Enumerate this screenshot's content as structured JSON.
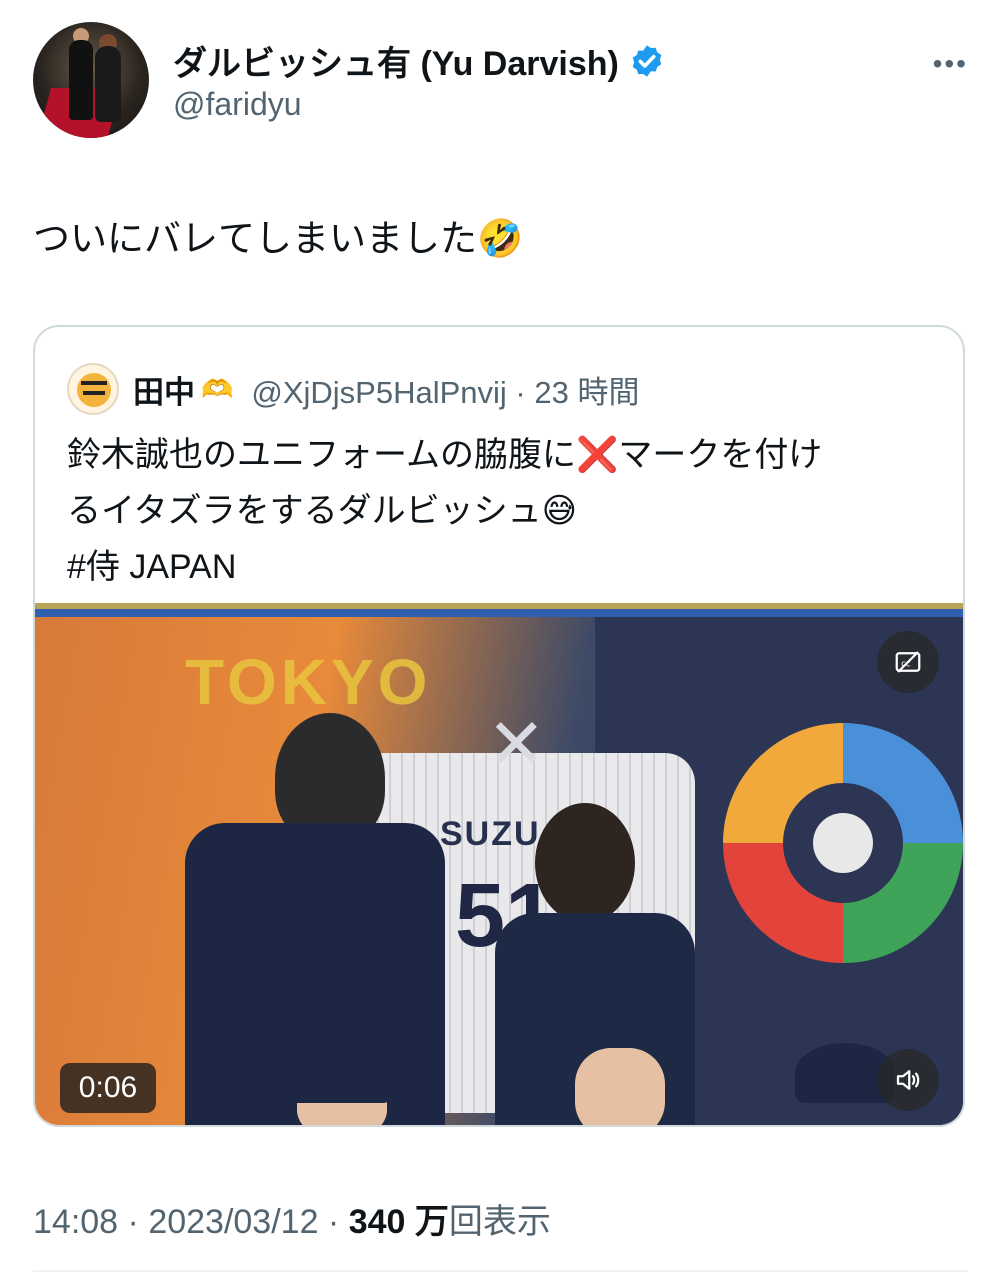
{
  "author": {
    "display_name": "ダルビッシュ有 (Yu Darvish)",
    "handle": "@faridyu",
    "verified": true
  },
  "more_icon": "•••",
  "tweet": {
    "text": "ついにバレてしまいました🤣"
  },
  "quote": {
    "name": "田中",
    "name_emoji": "🫶",
    "handle_time": "@XjDjsP5HalPnvij · 23 時間",
    "lines": [
      "鈴木誠也のユニフォームの脇腹に❌マークを付け",
      "るイタズラをするダルビッシュ😅",
      "#侍 JAPAN"
    ],
    "video": {
      "duration": "0:06",
      "scene_text_tokyo": "TOKYO",
      "jersey_name": "SUZU",
      "jersey_number": "51",
      "captions_icon": "captions-icon",
      "volume_icon": "volume-icon"
    }
  },
  "meta": {
    "time": "14:08",
    "date": "2023/03/12",
    "views_count": "340 万",
    "views_label": "回表示",
    "sep": " · "
  },
  "colors": {
    "verified_blue": "#1d9bf0",
    "secondary_text": "#536471",
    "border": "#cfd9de"
  }
}
